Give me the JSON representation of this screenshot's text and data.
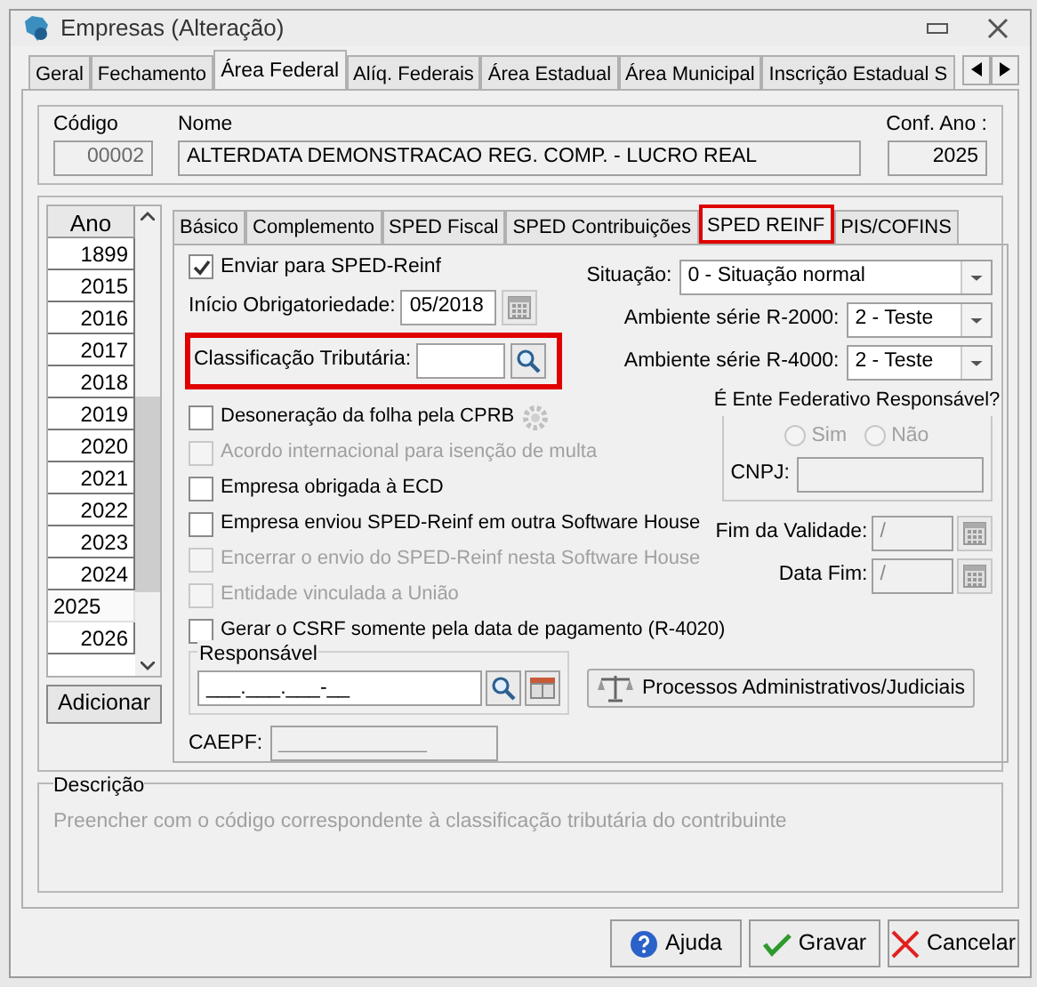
{
  "window": {
    "title": "Empresas (Alteração)"
  },
  "tabs": [
    {
      "label": "Geral",
      "selected": false
    },
    {
      "label": "Fechamento",
      "selected": false
    },
    {
      "label": "Área Federal",
      "selected": true
    },
    {
      "label": "Alíq. Federais",
      "selected": false
    },
    {
      "label": "Área Estadual",
      "selected": false
    },
    {
      "label": "Área Municipal",
      "selected": false
    },
    {
      "label": "Inscrição Estadual S",
      "selected": false
    }
  ],
  "header": {
    "codigo": {
      "label": "Código",
      "value": "00002"
    },
    "nome": {
      "label": "Nome",
      "value": "ALTERDATA DEMONSTRACAO REG. COMP. - LUCRO REAL"
    },
    "conf_ano": {
      "label": "Conf. Ano :",
      "value": "2025"
    }
  },
  "years": {
    "header": "Ano",
    "items": [
      {
        "label": "1899",
        "selected": false
      },
      {
        "label": "2015",
        "selected": false
      },
      {
        "label": "2016",
        "selected": false
      },
      {
        "label": "2017",
        "selected": false
      },
      {
        "label": "2018",
        "selected": false
      },
      {
        "label": "2019",
        "selected": false
      },
      {
        "label": "2020",
        "selected": false
      },
      {
        "label": "2021",
        "selected": false
      },
      {
        "label": "2022",
        "selected": false
      },
      {
        "label": "2023",
        "selected": false
      },
      {
        "label": "2024",
        "selected": false
      },
      {
        "label": "2025",
        "selected": true
      },
      {
        "label": "2026",
        "selected": false
      }
    ],
    "add_button": "Adicionar"
  },
  "inner_tabs": [
    {
      "label": "Básico",
      "selected": false,
      "highlighted": false
    },
    {
      "label": "Complemento",
      "selected": false,
      "highlighted": false
    },
    {
      "label": "SPED Fiscal",
      "selected": false,
      "highlighted": false
    },
    {
      "label": "SPED Contribuições",
      "selected": false,
      "highlighted": false
    },
    {
      "label": "SPED REINF",
      "selected": true,
      "highlighted": true
    },
    {
      "label": "PIS/COFINS",
      "selected": false,
      "highlighted": false
    }
  ],
  "sped_reinf": {
    "enviar": {
      "label": "Enviar para SPED-Reinf",
      "checked": true
    },
    "inicio": {
      "label": "Início Obrigatoriedade:",
      "value": "05/2018"
    },
    "classificacao": {
      "label": "Classificação Tributária:",
      "highlighted": true
    },
    "situacao": {
      "label": "Situação:",
      "value": "0 - Situação normal"
    },
    "ambiente_r2000": {
      "label": "Ambiente série R-2000:",
      "value": "2 - Teste"
    },
    "ambiente_r4000": {
      "label": "Ambiente série R-4000:",
      "value": "2 - Teste"
    },
    "options": [
      {
        "label": "Desoneração da folha pela CPRB",
        "checked": false,
        "disabled": false,
        "has_settings": true
      },
      {
        "label": "Acordo internacional para isenção de multa",
        "checked": false,
        "disabled": true,
        "has_settings": false
      },
      {
        "label": "Empresa obrigada à ECD",
        "checked": false,
        "disabled": false,
        "has_settings": false
      },
      {
        "label": "Empresa enviou SPED-Reinf em outra Software House",
        "checked": false,
        "disabled": false,
        "has_settings": false
      },
      {
        "label": "Encerrar o envio do SPED-Reinf nesta Software House",
        "checked": false,
        "disabled": true,
        "has_settings": false
      },
      {
        "label": "Entidade vinculada a União",
        "checked": false,
        "disabled": true,
        "has_settings": false
      },
      {
        "label": "Gerar o CSRF somente pela data de pagamento (R-4020)",
        "checked": false,
        "disabled": false,
        "has_settings": false
      }
    ],
    "ente_federativo": {
      "title": "É Ente Federativo Responsável?",
      "disabled": true,
      "options": [
        {
          "label": "Sim",
          "selected": false
        },
        {
          "label": "Não",
          "selected": false
        }
      ],
      "cnpj_label": "CNPJ:"
    },
    "fim_validade": {
      "label": "Fim da Validade:",
      "value": "/"
    },
    "data_fim": {
      "label": "Data Fim:",
      "value": "/"
    },
    "responsavel": {
      "title": "Responsável",
      "value": "___.___.___-__"
    },
    "processos_button": "Processos Administrativos/Judiciais",
    "caepf": {
      "label": "CAEPF:",
      "value": "_______________"
    }
  },
  "descricao": {
    "title": "Descrição",
    "text": "Preencher com o código correspondente à classificação tributária do contribuinte"
  },
  "buttons": [
    {
      "label": "Ajuda",
      "kind": "help"
    },
    {
      "label": "Gravar",
      "kind": "save"
    },
    {
      "label": "Cancelar",
      "kind": "cancel"
    }
  ]
}
